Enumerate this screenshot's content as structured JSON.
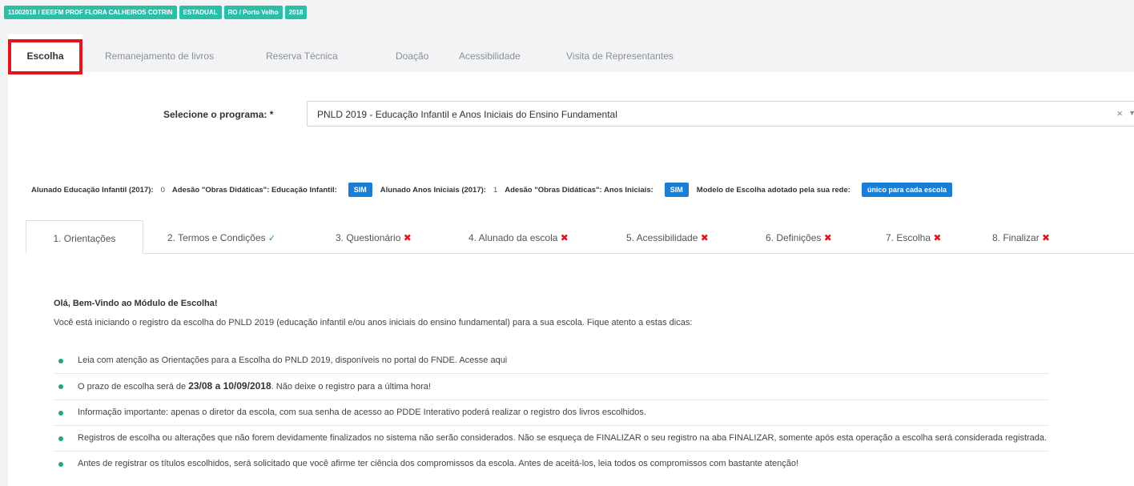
{
  "badges": [
    "11002018 / EEEFM PROF FLORA CALHEIROS COTRIN",
    "ESTADUAL",
    "RO / Porto Velho",
    "2018"
  ],
  "top_tabs": [
    "Escolha",
    "Remanejamento de livros",
    "Reserva Técnica",
    "Doação",
    "Acessibilidade",
    "Visita de Representantes"
  ],
  "program": {
    "label": "Selecione o programa: *",
    "value": "PNLD 2019 - Educação Infantil e Anos Iniciais do Ensino Fundamental",
    "clear_glyph": "×",
    "caret_glyph": "▼"
  },
  "info": {
    "alunado_infantil_label": "Alunado Educação Infantil (2017):",
    "alunado_infantil_value": "0",
    "adesao_infantil_label": "Adesão \"Obras Didáticas\": Educação Infantil:",
    "adesao_infantil_value": "SIM",
    "alunado_iniciais_label": "Alunado Anos Iniciais (2017):",
    "alunado_iniciais_value": "1",
    "adesao_iniciais_label": "Adesão \"Obras Didáticas\": Anos Iniciais:",
    "adesao_iniciais_value": "SIM",
    "modelo_label": "Modelo de Escolha adotado pela sua rede:",
    "modelo_value": "único para cada escola"
  },
  "steps": [
    {
      "label": "1. Orientações",
      "status": ""
    },
    {
      "label": "2. Termos e Condições",
      "status": "✓"
    },
    {
      "label": "3. Questionário",
      "status": "✖"
    },
    {
      "label": "4. Alunado da escola",
      "status": "✖"
    },
    {
      "label": "5. Acessibilidade",
      "status": "✖"
    },
    {
      "label": "6. Definições",
      "status": "✖"
    },
    {
      "label": "7. Escolha",
      "status": "✖"
    },
    {
      "label": "8. Finalizar",
      "status": "✖"
    }
  ],
  "content": {
    "welcome": "Olá, Bem-Vindo ao Módulo de Escolha!",
    "intro": "Você está iniciando o registro da escolha do PNLD 2019 (educação infantil e/ou anos iniciais do ensino fundamental) para a sua escola. Fique atento a estas dicas:",
    "tip1": "Leia com atenção as Orientações para a Escolha do PNLD 2019, disponíveis no portal do FNDE. Acesse aqui",
    "tip2_pre": "O prazo de escolha será de ",
    "tip2_bold": "23/08 a 10/09/2018",
    "tip2_post": ". Não deixe o registro para a última hora!",
    "tip3": "Informação importante: apenas o diretor da escola, com sua senha de acesso ao PDDE Interativo poderá realizar o registro dos livros escolhidos.",
    "tip4": "Registros de escolha ou alterações que não forem devidamente finalizados no sistema não serão considerados. Não se esqueça de FINALIZAR o seu registro na aba FINALIZAR, somente após esta operação a escolha será considerada registrada.",
    "tip5": "Antes de registrar os títulos escolhidos, será solicitado que você afirme ter ciência dos compromissos da escola. Antes de aceitá-los, leia todos os compromissos com bastante atenção!"
  }
}
